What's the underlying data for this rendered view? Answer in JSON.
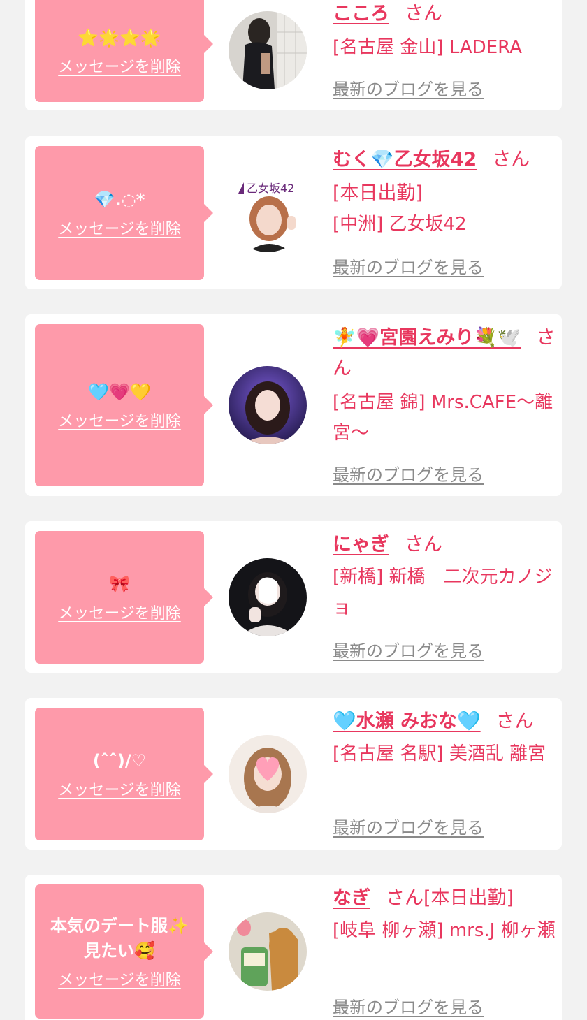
{
  "common": {
    "delete_label": "メッセージを削除",
    "blog_label": "最新のブログを見る",
    "san": "さん"
  },
  "entries": [
    {
      "message": "⭐🌟⭐🌟",
      "name": "こころ",
      "status": "",
      "shop": "[名古屋 金山] LADERA"
    },
    {
      "message": "💎.◌*",
      "name": "むく💎乙女坂42",
      "status": "[本日出勤]",
      "shop": "[中洲] 乙女坂42"
    },
    {
      "message": "🩵💗💛",
      "name": "🧚💗宮園えみり💐🕊️",
      "status": "",
      "shop": "[名古屋 錦] Mrs.CAFE〜離宮〜"
    },
    {
      "message": "🎀",
      "name": "にゃぎ",
      "status": "",
      "shop": "[新橋] 新橋　二次元カノジョ"
    },
    {
      "message": "(ˆˆ)/♡",
      "name": "🩵水瀬 みおな🩵",
      "status": "",
      "shop": "[名古屋 名駅] 美酒乱 離宮"
    },
    {
      "message": "本気のデート服✨\n見たい🥰",
      "name": "なぎ",
      "status": "[本日出勤]",
      "shop": "[岐阜 柳ヶ瀬] mrs.J 柳ヶ瀬"
    }
  ]
}
